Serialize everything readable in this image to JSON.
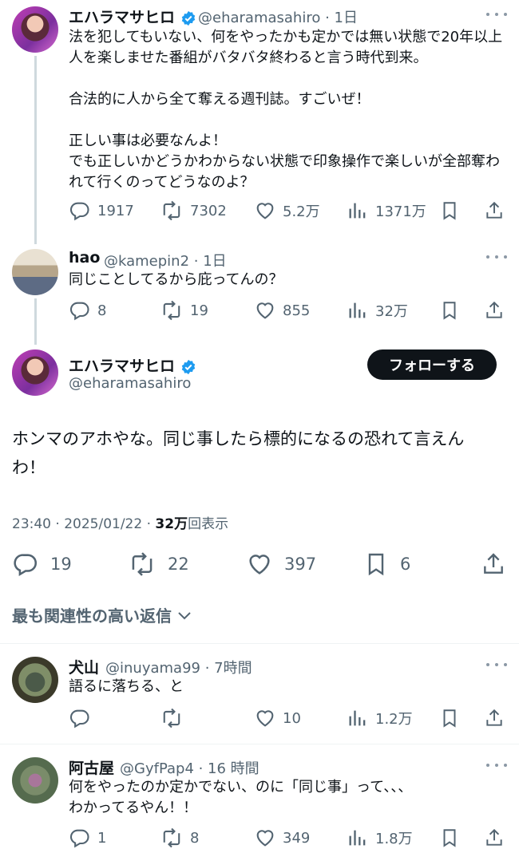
{
  "thread": {
    "post1": {
      "name": "エハラマサヒロ",
      "handle": "@eharamasahiro · 1日",
      "body": "法を犯してもいない、何をやったかも定かでは無い状態で20年以上人を楽しませた番組がバタバタ終わると言う時代到来。\n\n合法的に人から全て奪える週刊誌。すごいぜ！\n\n正しい事は必要なんよ！\nでも正しいかどうかわからない状態で印象操作で楽しいが全部奪われて行くのってどうなのよ？",
      "replies": "1917",
      "reposts": "7302",
      "likes": "5.2万",
      "views": "1371万"
    },
    "post2": {
      "name": "hao",
      "handle": "@kamepin2 · 1日",
      "body": "同じことしてるから庇ってんの？",
      "replies": "8",
      "reposts": "19",
      "likes": "855",
      "views": "32万"
    }
  },
  "main": {
    "name": "エハラマサヒロ",
    "handle": "@eharamasahiro",
    "follow_label": "フォローする",
    "body": "ホンマのアホやな。同じ事したら標的になるの恐れて言えんわ！",
    "timestamp": "23:40 · 2025/01/22 · ",
    "views_count": "32万",
    "views_label": "回表示",
    "replies": "19",
    "reposts": "22",
    "likes": "397",
    "bookmarks": "6"
  },
  "sort_label": "最も関連性の高い返信",
  "replies": [
    {
      "name": "犬山",
      "handle": "@inuyama99 · 7時間",
      "body": "語るに落ちる、と",
      "likes": "10",
      "views": "1.2万"
    },
    {
      "name": "阿古屋",
      "handle": "@GyfPap4 · 16 時間",
      "body": "何をやったのか定かでない、のに「同じ事」って、、、\nわかってるやん！！",
      "replies": "1",
      "reposts": "8",
      "likes": "349",
      "views": "1.8万"
    }
  ],
  "colors": {
    "verified": "#1d9bf0",
    "secondary_text": "#536471",
    "follow_button": "#0f1419"
  }
}
